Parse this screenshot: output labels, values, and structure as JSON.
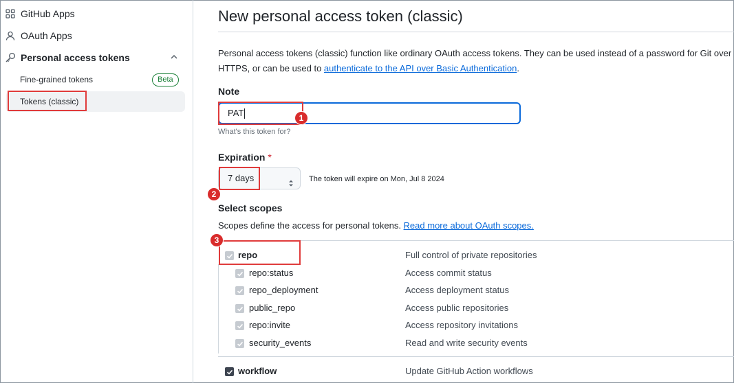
{
  "sidebar": {
    "items": [
      {
        "label": "GitHub Apps",
        "icon": "apps-grid-icon"
      },
      {
        "label": "OAuth Apps",
        "icon": "person-icon"
      },
      {
        "label": "Personal access tokens",
        "icon": "key-icon"
      }
    ],
    "sub_items": [
      {
        "label": "Fine-grained tokens",
        "badge": "Beta"
      },
      {
        "label": "Tokens (classic)"
      }
    ]
  },
  "main": {
    "title": "New personal access token (classic)",
    "intro_text": "Personal access tokens (classic) function like ordinary OAuth access tokens. They can be used instead of a password for Git over HTTPS, or can be used to ",
    "intro_link": "authenticate to the API over Basic Authentication",
    "intro_end": ".",
    "note": {
      "label": "Note",
      "value": "PAT",
      "hint": "What's this token for?"
    },
    "expiration": {
      "label": "Expiration",
      "required_mark": "*",
      "selected": "7 days",
      "message": "The token will expire on Mon, Jul 8 2024"
    },
    "scopes": {
      "label": "Select scopes",
      "description": "Scopes define the access for personal tokens. ",
      "link": "Read more about OAuth scopes.",
      "items": [
        {
          "name": "repo",
          "description": "Full control of private repositories",
          "checked": true
        },
        {
          "name": "repo:status",
          "description": "Access commit status",
          "checked": true
        },
        {
          "name": "repo_deployment",
          "description": "Access deployment status",
          "checked": true
        },
        {
          "name": "public_repo",
          "description": "Access public repositories",
          "checked": true
        },
        {
          "name": "repo:invite",
          "description": "Access repository invitations",
          "checked": true
        },
        {
          "name": "security_events",
          "description": "Read and write security events",
          "checked": true
        },
        {
          "name": "workflow",
          "description": "Update GitHub Action workflows",
          "checked": true
        }
      ]
    }
  },
  "annotations": {
    "markers": [
      "1",
      "2",
      "3"
    ],
    "highlight_color": "#e03b3b"
  },
  "colors": {
    "link": "#0969da",
    "badge": "#1a7f37",
    "focus": "#0969da"
  }
}
